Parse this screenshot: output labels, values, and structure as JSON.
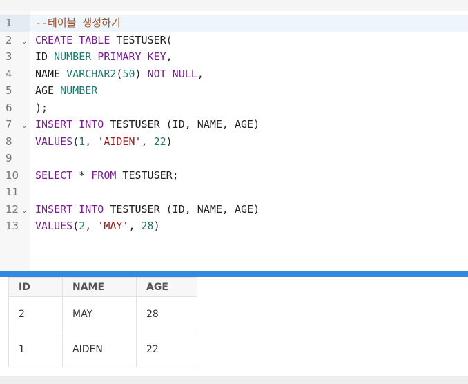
{
  "editor": {
    "lines": [
      {
        "n": "1",
        "tokens": [
          {
            "t": "--테이블 생성하기",
            "c": "cm"
          }
        ]
      },
      {
        "n": "2",
        "tokens": [
          {
            "t": "CREATE TABLE",
            "c": "kw"
          },
          {
            "t": " TESTUSER(",
            "c": "op"
          }
        ]
      },
      {
        "n": "3",
        "tokens": [
          {
            "t": "ID ",
            "c": "op"
          },
          {
            "t": "NUMBER",
            "c": "ty"
          },
          {
            "t": " ",
            "c": "op"
          },
          {
            "t": "PRIMARY KEY",
            "c": "kw"
          },
          {
            "t": ",",
            "c": "op"
          }
        ]
      },
      {
        "n": "4",
        "tokens": [
          {
            "t": "NAME ",
            "c": "op"
          },
          {
            "t": "VARCHAR2",
            "c": "ty"
          },
          {
            "t": "(",
            "c": "op"
          },
          {
            "t": "50",
            "c": "num-lit"
          },
          {
            "t": ") ",
            "c": "op"
          },
          {
            "t": "NOT NULL",
            "c": "kw"
          },
          {
            "t": ",",
            "c": "op"
          }
        ]
      },
      {
        "n": "5",
        "tokens": [
          {
            "t": "AGE ",
            "c": "op"
          },
          {
            "t": "NUMBER",
            "c": "ty"
          }
        ]
      },
      {
        "n": "6",
        "tokens": [
          {
            "t": ");",
            "c": "op"
          }
        ]
      },
      {
        "n": "7",
        "tokens": [
          {
            "t": "INSERT INTO",
            "c": "kw"
          },
          {
            "t": " TESTUSER (ID, NAME, AGE)",
            "c": "op"
          }
        ]
      },
      {
        "n": "8",
        "tokens": [
          {
            "t": "VALUES",
            "c": "kw"
          },
          {
            "t": "(",
            "c": "op"
          },
          {
            "t": "1",
            "c": "num-lit"
          },
          {
            "t": ", ",
            "c": "op"
          },
          {
            "t": "'AIDEN'",
            "c": "str"
          },
          {
            "t": ", ",
            "c": "op"
          },
          {
            "t": "22",
            "c": "num-lit"
          },
          {
            "t": ")",
            "c": "op"
          }
        ]
      },
      {
        "n": "9",
        "tokens": []
      },
      {
        "n": "10",
        "tokens": [
          {
            "t": "SELECT",
            "c": "kw"
          },
          {
            "t": " * ",
            "c": "op"
          },
          {
            "t": "FROM",
            "c": "kw"
          },
          {
            "t": " TESTUSER;",
            "c": "op"
          }
        ]
      },
      {
        "n": "11",
        "tokens": []
      },
      {
        "n": "12",
        "tokens": [
          {
            "t": "INSERT INTO",
            "c": "kw"
          },
          {
            "t": " TESTUSER (ID, NAME, AGE)",
            "c": "op"
          }
        ]
      },
      {
        "n": "13",
        "tokens": [
          {
            "t": "VALUES",
            "c": "kw"
          },
          {
            "t": "(",
            "c": "op"
          },
          {
            "t": "2",
            "c": "num-lit"
          },
          {
            "t": ", ",
            "c": "op"
          },
          {
            "t": "'MAY'",
            "c": "str"
          },
          {
            "t": ", ",
            "c": "op"
          },
          {
            "t": "28",
            "c": "num-lit"
          },
          {
            "t": ")",
            "c": "op"
          }
        ]
      }
    ],
    "fold_lines": [
      "2",
      "7",
      "12"
    ],
    "active_line": "1",
    "fold_icon": "chevron-down-icon"
  },
  "results": {
    "columns": [
      "ID",
      "NAME",
      "AGE"
    ],
    "rows": [
      [
        "2",
        "MAY",
        "28"
      ],
      [
        "1",
        "AIDEN",
        "22"
      ]
    ]
  },
  "colors": {
    "divider": "#2f8ae0",
    "keyword": "#7a1f8f",
    "type": "#1d7a6e",
    "string": "#a11c1c",
    "comment": "#a0522d"
  }
}
